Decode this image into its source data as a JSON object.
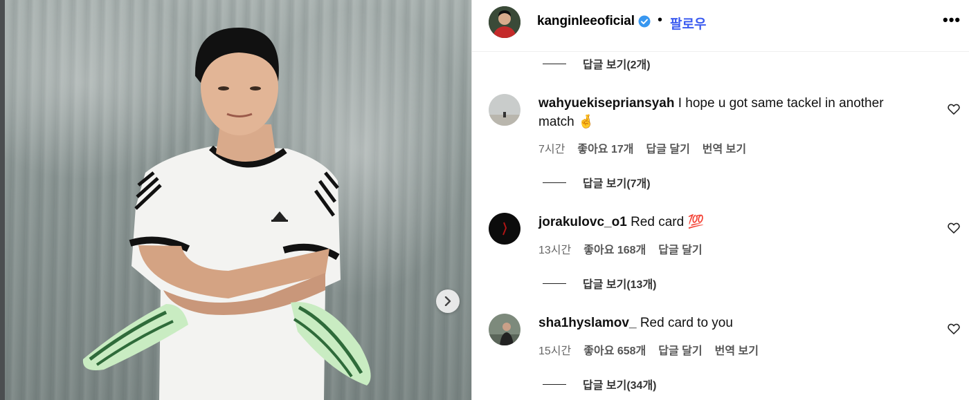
{
  "post": {
    "username": "kanginleeoficial",
    "verified": true,
    "separator": "•",
    "follow_label": "팔로우",
    "more_icon": "more-options-icon",
    "more_label": "•••"
  },
  "colors": {
    "follow_blue": "#3b5bf0",
    "verified_blue": "#3897f0",
    "meta_gray": "#666666"
  },
  "reply_toggles": [
    "답글 보기(2개)",
    "답글 보기(7개)",
    "답글 보기(13개)",
    "답글 보기(34개)"
  ],
  "comments": [
    {
      "username": "wahyuekisepriansyah",
      "text": "I hope u got same tackel in another match",
      "emoji": "🤞",
      "time": "7시간",
      "likes": "좋아요 17개",
      "reply": "답글 달기",
      "translate": "번역 보기"
    },
    {
      "username": "jorakulovc_o1",
      "text": "Red card",
      "emoji": "💯",
      "time": "13시간",
      "likes": "좋아요 168개",
      "reply": "답글 달기",
      "translate": ""
    },
    {
      "username": "sha1hyslamov_",
      "text": "Red card to you",
      "emoji": "",
      "time": "15시간",
      "likes": "좋아요 658개",
      "reply": "답글 달기",
      "translate": "번역 보기"
    }
  ]
}
